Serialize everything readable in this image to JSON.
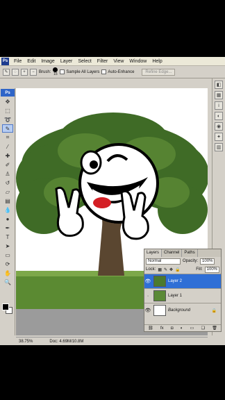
{
  "menubar": {
    "items": [
      "File",
      "Edit",
      "Image",
      "Layer",
      "Select",
      "Filter",
      "View",
      "Window",
      "Help"
    ]
  },
  "options": {
    "brush_label": "Brush:",
    "brush_size": "15",
    "sample_all_layers": "Sample All Layers",
    "auto_enhance": "Auto-Enhance",
    "refine_edge": "Refine Edge..."
  },
  "toolbox": {
    "header": "Ps"
  },
  "status": {
    "zoom": "38.75%",
    "doc": "Doc: 4.69M/10.8M"
  },
  "layers_panel": {
    "tabs": [
      "Layers",
      "Channel",
      "Paths"
    ],
    "blend_mode": "Normal",
    "opacity_label": "Opacity:",
    "opacity_value": "100%",
    "lock_label": "Lock:",
    "fill_label": "Fill:",
    "fill_value": "100%",
    "layers": [
      {
        "name": "Layer 2",
        "selected": true
      },
      {
        "name": "Layer 1",
        "selected": false
      },
      {
        "name": "Background",
        "selected": false
      }
    ]
  },
  "colors": {
    "selection": "#2f6fd6",
    "ps_blue": "#1d3b8f"
  }
}
